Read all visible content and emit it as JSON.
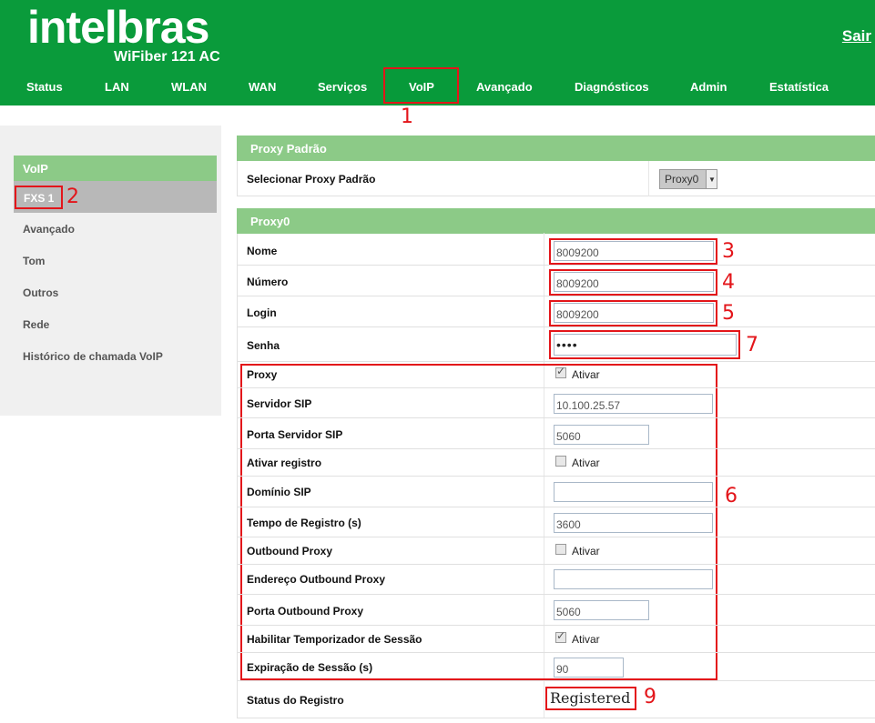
{
  "brand": {
    "logo": "intelbras",
    "model": "WiFiber 121 AC",
    "logout": "Sair"
  },
  "nav": [
    "Status",
    "LAN",
    "WLAN",
    "WAN",
    "Serviços",
    "VoIP",
    "Avançado",
    "Diagnósticos",
    "Admin",
    "Estatística"
  ],
  "annotations": [
    "1",
    "2",
    "3",
    "4",
    "5",
    "6",
    "7",
    "9"
  ],
  "sidebar": {
    "section": "VoIP",
    "selected": "FXS 1",
    "items": [
      "Avançado",
      "Tom",
      "Outros",
      "Rede",
      "Histórico de chamada VoIP"
    ]
  },
  "proxy_padrao": {
    "title": "Proxy Padrão",
    "label": "Selecionar Proxy Padrão",
    "value": "Proxy0"
  },
  "proxy0": {
    "title": "Proxy0",
    "nome": {
      "label": "Nome",
      "value": "8009200"
    },
    "numero": {
      "label": "Número",
      "value": "8009200"
    },
    "login": {
      "label": "Login",
      "value": "8009200"
    },
    "senha": {
      "label": "Senha",
      "value": "••••"
    },
    "proxy": {
      "label": "Proxy",
      "checked": true,
      "option": "Ativar"
    },
    "servidor_sip": {
      "label": "Servidor SIP",
      "value": "10.100.25.57"
    },
    "porta_servidor_sip": {
      "label": "Porta Servidor SIP",
      "value": "5060"
    },
    "ativar_registro": {
      "label": "Ativar registro",
      "checked": false,
      "option": "Ativar"
    },
    "dominio_sip": {
      "label": "Domínio SIP",
      "value": ""
    },
    "tempo_registro": {
      "label": "Tempo de Registro (s)",
      "value": "3600"
    },
    "outbound_proxy": {
      "label": "Outbound Proxy",
      "checked": false,
      "option": "Ativar"
    },
    "endereco_outbound": {
      "label": "Endereço Outbound Proxy",
      "value": ""
    },
    "porta_outbound": {
      "label": "Porta Outbound Proxy",
      "value": "5060"
    },
    "temporizador": {
      "label": "Habilitar Temporizador de Sessão",
      "checked": true,
      "option": "Ativar"
    },
    "expiracao": {
      "label": "Expiração de Sessão (s)",
      "value": "90"
    },
    "status": {
      "label": "Status do Registro",
      "value": "Registered"
    }
  },
  "colors": {
    "header_green": "#0a9b3b",
    "panel_green": "#8cca87",
    "annotation_red": "#e3151a"
  }
}
